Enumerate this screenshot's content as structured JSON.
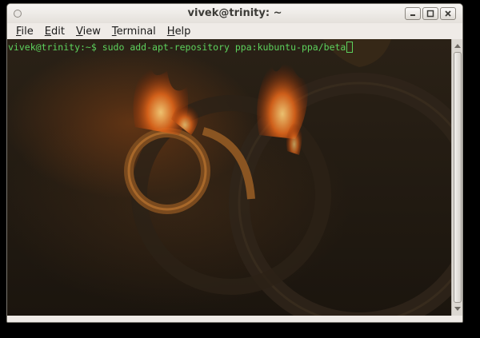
{
  "window": {
    "title": "vivek@trinity: ~"
  },
  "menu": [
    {
      "pre": "",
      "mnemonic": "F",
      "post": "ile"
    },
    {
      "pre": "",
      "mnemonic": "E",
      "post": "dit"
    },
    {
      "pre": "",
      "mnemonic": "V",
      "post": "iew"
    },
    {
      "pre": "",
      "mnemonic": "T",
      "post": "erminal"
    },
    {
      "pre": "",
      "mnemonic": "H",
      "post": "elp"
    }
  ],
  "terminal": {
    "prompt": "vivek@trinity:~$ ",
    "command": "sudo add-apt-repository ppa:kubuntu-ppa/beta",
    "text_color": "#5dd25d"
  },
  "icons": {
    "window_menu": "window-menu-icon",
    "minimize": "minimize-icon",
    "maximize": "maximize-icon",
    "close": "close-icon"
  }
}
